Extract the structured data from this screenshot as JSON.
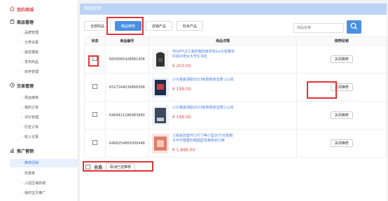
{
  "brand": {
    "label": "我的商城"
  },
  "sidebar": {
    "sections": [
      {
        "title": "商品管理",
        "items": [
          "品牌管理",
          "分类设置",
          "属性模板",
          "发布商品",
          "库存管理"
        ]
      },
      {
        "title": "交易管理",
        "items": [
          "择运审核",
          "我的订单",
          "评价管理",
          "历史订单",
          "收入记录"
        ]
      },
      {
        "title": "推广营销",
        "items": [
          "推荐促销",
          "优惠劵",
          "入驻区域商城",
          "我的宝贝推广"
        ]
      }
    ]
  },
  "header": {
    "title": "推荐促销"
  },
  "tabs": [
    "全部商品",
    "精品推荐",
    "促销产品",
    "秒杀产品"
  ],
  "search": {
    "placeholder": "商品名称"
  },
  "table": {
    "headers": [
      "状态",
      "商品编号",
      "商品详情",
      "推荐促销"
    ],
    "rows": [
      {
        "code": "6609365428881408",
        "title": "TRUFFLE工装机箱双肩背包ins大容量初中高中男女大学生书包",
        "price": "¥ 203.00",
        "action": "关闭推荐"
      },
      {
        "code": "6527244039866368",
        "title": "小众春夏通勤2023新款随意音质小心机",
        "price": "¥ 199.00",
        "action": "关闭推荐"
      },
      {
        "code": "6469421286983680",
        "title": "小众春夏通勤2023新款随意音质小心机",
        "price": "¥ 199.00",
        "action": "关闭推荐"
      },
      {
        "code": "6468254865000448",
        "title": "土城桌前室开口尺寸等小型20寸女款帽子可开展整形椭圆型性格帽衣行裤",
        "price": "¥ 1,899.00",
        "action": "关闭推荐"
      }
    ]
  },
  "footer": {
    "select_all": "全选",
    "cancel_label": "取消已选推荐"
  },
  "colors": {
    "accent": "#4a90e2",
    "brand": "#e04848",
    "highlight": "#e23333"
  }
}
